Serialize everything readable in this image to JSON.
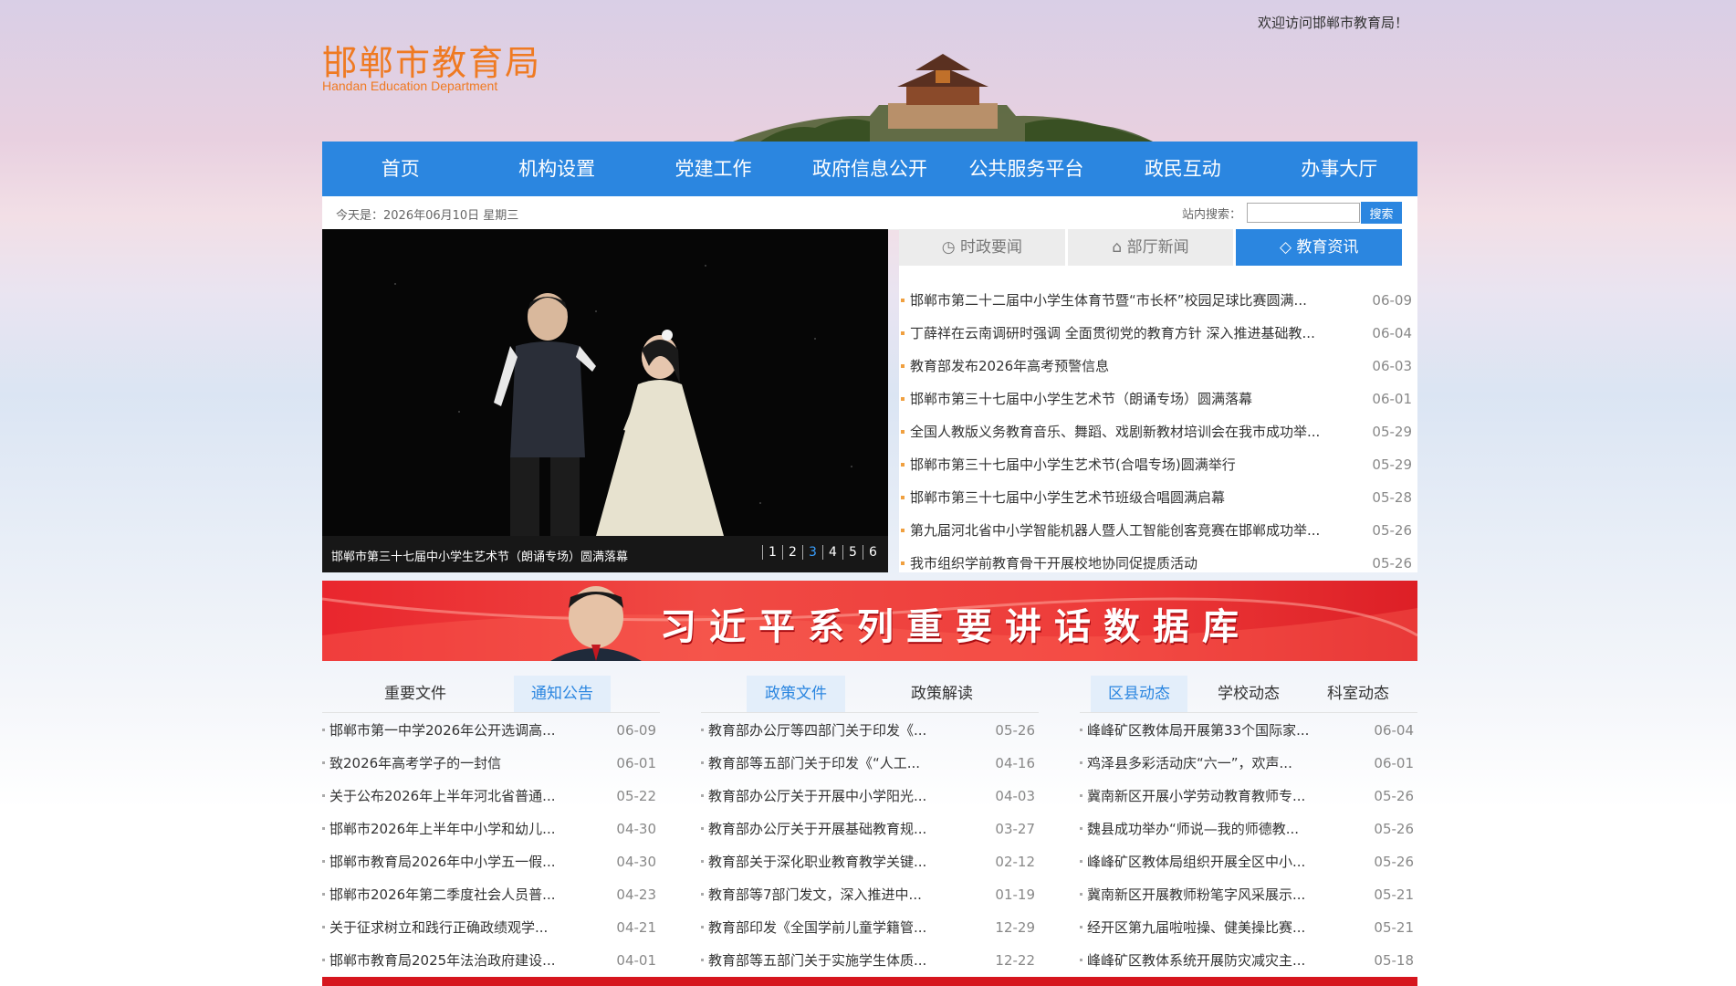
{
  "header": {
    "logo_cn": "邯郸市教育局",
    "logo_en": "Handan Education Department",
    "welcome": "欢迎访问邯郸市教育局！"
  },
  "nav": {
    "items": [
      "首页",
      "机构设置",
      "党建工作",
      "政府信息公开",
      "公共服务平台",
      "政民互动",
      "办事大厅"
    ]
  },
  "toolbar": {
    "today": "今天是：2026年06月10日 星期三",
    "search_label": "站内搜索：",
    "search_value": "",
    "search_button": "搜索"
  },
  "slider": {
    "caption": "邯郸市第三十七届中小学生艺术节（朗诵专场）圆满落幕",
    "pages": [
      "1",
      "2",
      "3",
      "4",
      "5",
      "6"
    ],
    "active_page": 3
  },
  "news": {
    "tabs": [
      {
        "label": "时政要闻",
        "icon": "clock-icon"
      },
      {
        "label": "部厅新闻",
        "icon": "building-icon"
      },
      {
        "label": "教育资讯",
        "icon": "graduation-cap-icon"
      }
    ],
    "active_tab": 2,
    "items": [
      {
        "title": "邯郸市第二十二届中小学生体育节暨“市长杯”校园足球比赛圆满...",
        "date": "06-09"
      },
      {
        "title": "丁薛祥在云南调研时强调 全面贯彻党的教育方针 深入推进基础教...",
        "date": "06-04"
      },
      {
        "title": "教育部发布2026年高考预警信息",
        "date": "06-03"
      },
      {
        "title": "邯郸市第三十七届中小学生艺术节（朗诵专场）圆满落幕",
        "date": "06-01"
      },
      {
        "title": "全国人教版义务教育音乐、舞蹈、戏剧新教材培训会在我市成功举...",
        "date": "05-29"
      },
      {
        "title": "邯郸市第三十七届中小学生艺术节(合唱专场)圆满举行",
        "date": "05-29"
      },
      {
        "title": "邯郸市第三十七届中小学生艺术节班级合唱圆满启幕",
        "date": "05-28"
      },
      {
        "title": "第九届河北省中小学智能机器人暨人工智能创客竞赛在邯郸成功举...",
        "date": "05-26"
      },
      {
        "title": "我市组织学前教育骨干开展校地协同促提质活动",
        "date": "05-26"
      }
    ]
  },
  "banner": {
    "text": "习近平系列重要讲话数据库"
  },
  "columns": [
    {
      "tabs": [
        "重要文件",
        "通知公告"
      ],
      "active_tab": 1,
      "items": [
        {
          "title": "邯郸市第一中学2026年公开选调高...",
          "date": "06-09"
        },
        {
          "title": "致2026年高考学子的一封信",
          "date": "06-01"
        },
        {
          "title": "关于公布2026年上半年河北省普通...",
          "date": "05-22"
        },
        {
          "title": "邯郸市2026年上半年中小学和幼儿...",
          "date": "04-30"
        },
        {
          "title": "邯郸市教育局2026年中小学五一假...",
          "date": "04-30"
        },
        {
          "title": "邯郸市2026年第二季度社会人员普...",
          "date": "04-23"
        },
        {
          "title": "关于征求树立和践行正确政绩观学...",
          "date": "04-21"
        },
        {
          "title": "邯郸市教育局2025年法治政府建设...",
          "date": "04-01"
        }
      ]
    },
    {
      "tabs": [
        "政策文件",
        "政策解读"
      ],
      "active_tab": 0,
      "items": [
        {
          "title": "教育部办公厅等四部门关于印发《...",
          "date": "05-26"
        },
        {
          "title": "教育部等五部门关于印发《“人工...",
          "date": "04-16"
        },
        {
          "title": "教育部办公厅关于开展中小学阳光...",
          "date": "04-03"
        },
        {
          "title": "教育部办公厅关于开展基础教育规...",
          "date": "03-27"
        },
        {
          "title": "教育部关于深化职业教育教学关键...",
          "date": "02-12"
        },
        {
          "title": "教育部等7部门发文，深入推进中...",
          "date": "01-19"
        },
        {
          "title": "教育部印发《全国学前儿童学籍管...",
          "date": "12-29"
        },
        {
          "title": "教育部等五部门关于实施学生体质...",
          "date": "12-22"
        }
      ]
    },
    {
      "tabs": [
        "区县动态",
        "学校动态",
        "科室动态"
      ],
      "active_tab": 0,
      "items": [
        {
          "title": "峰峰矿区教体局开展第33个国际家...",
          "date": "06-04"
        },
        {
          "title": "鸡泽县多彩活动庆“六一”，欢声...",
          "date": "06-01"
        },
        {
          "title": "冀南新区开展小学劳动教育教师专...",
          "date": "05-26"
        },
        {
          "title": "魏县成功举办“师说—我的师德教...",
          "date": "05-26"
        },
        {
          "title": "峰峰矿区教体局组织开展全区中小...",
          "date": "05-26"
        },
        {
          "title": "冀南新区开展教师粉笔字风采展示...",
          "date": "05-21"
        },
        {
          "title": "经开区第九届啦啦操、健美操比赛...",
          "date": "05-21"
        },
        {
          "title": "峰峰矿区教体系统开展防灾减灾主...",
          "date": "05-18"
        }
      ]
    }
  ],
  "colors": {
    "nav_blue": "#2b86e0",
    "logo_orange": "#ef7a22",
    "banner_red": "#e9262d",
    "tab_active_bg": "#e3eefa"
  }
}
